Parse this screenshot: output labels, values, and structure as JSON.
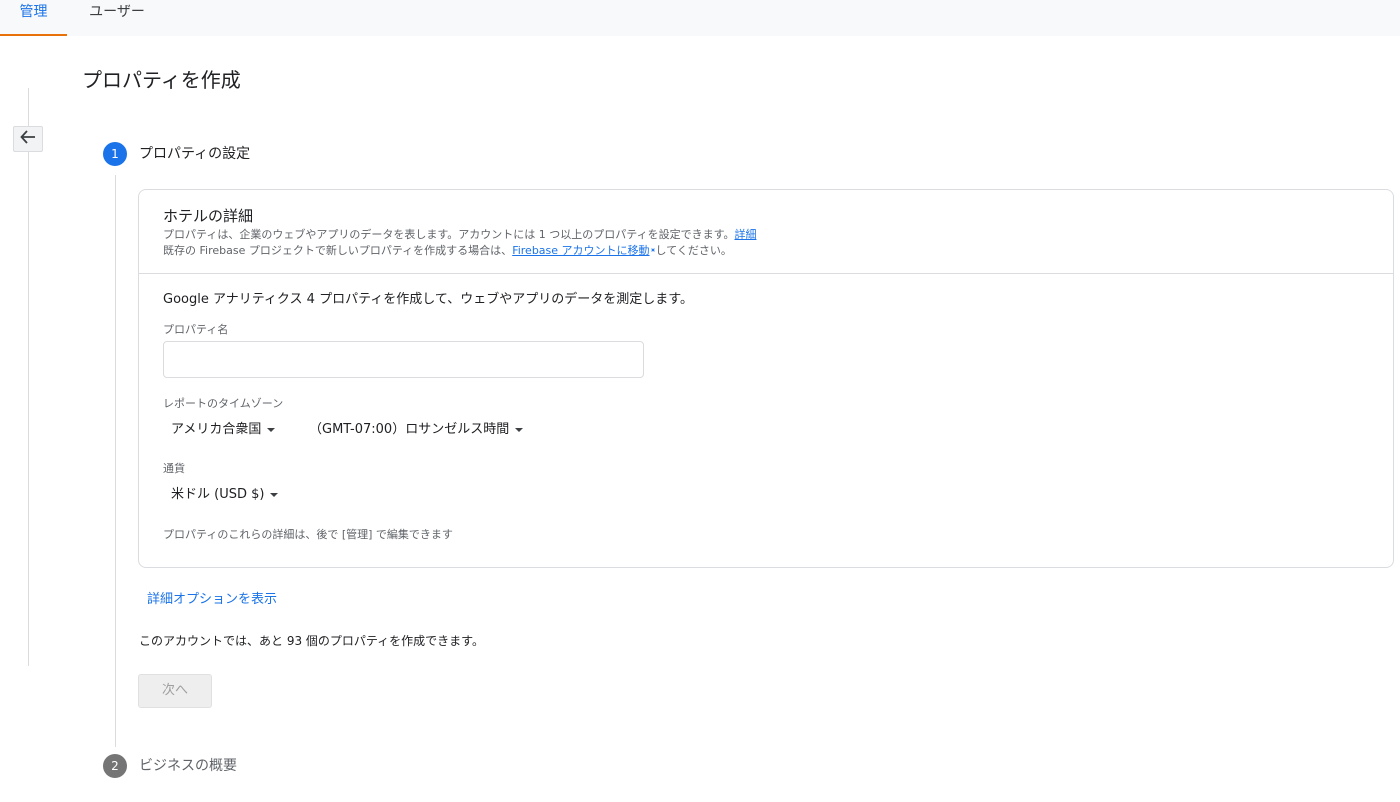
{
  "tabs": [
    {
      "label": "管理"
    },
    {
      "label": "ユーザー"
    }
  ],
  "page_title": "プロパティを作成",
  "steps": [
    {
      "number": "1",
      "label": "プロパティの設定"
    },
    {
      "number": "2",
      "label": "ビジネスの概要"
    }
  ],
  "card": {
    "title": "ホテルの詳細",
    "desc1_text": "プロパティは、企業のウェブやアプリのデータを表します。アカウントには 1 つ以上のプロパティを設定できます。",
    "desc1_link": "詳細",
    "desc2_prefix": "既存の Firebase プロジェクトで新しいプロパティを作成する場合は、",
    "desc2_link": "Firebase アカウントに移動",
    "desc2_suffix": "してください。",
    "intro": "Google アナリティクス 4 プロパティを作成して、ウェブやアプリのデータを測定します。",
    "property_name_label": "プロパティ名",
    "property_name_value": "",
    "timezone_label": "レポートのタイムゾーン",
    "country_value": "アメリカ合衆国",
    "timezone_value": "（GMT-07:00）ロサンゼルス時間",
    "currency_label": "通貨",
    "currency_value": "米ドル (USD $)",
    "note": "プロパティのこれらの詳細は、後で [管理] で編集できます"
  },
  "advanced_options_link": "詳細オプションを表示",
  "remaining_text": "このアカウントでは、あと 93 個のプロパティを作成できます。",
  "next_button_label": "次へ",
  "colors": {
    "accent": "#1a73e8",
    "tab_indicator": "#e8710a",
    "step_inactive": "#757575"
  }
}
